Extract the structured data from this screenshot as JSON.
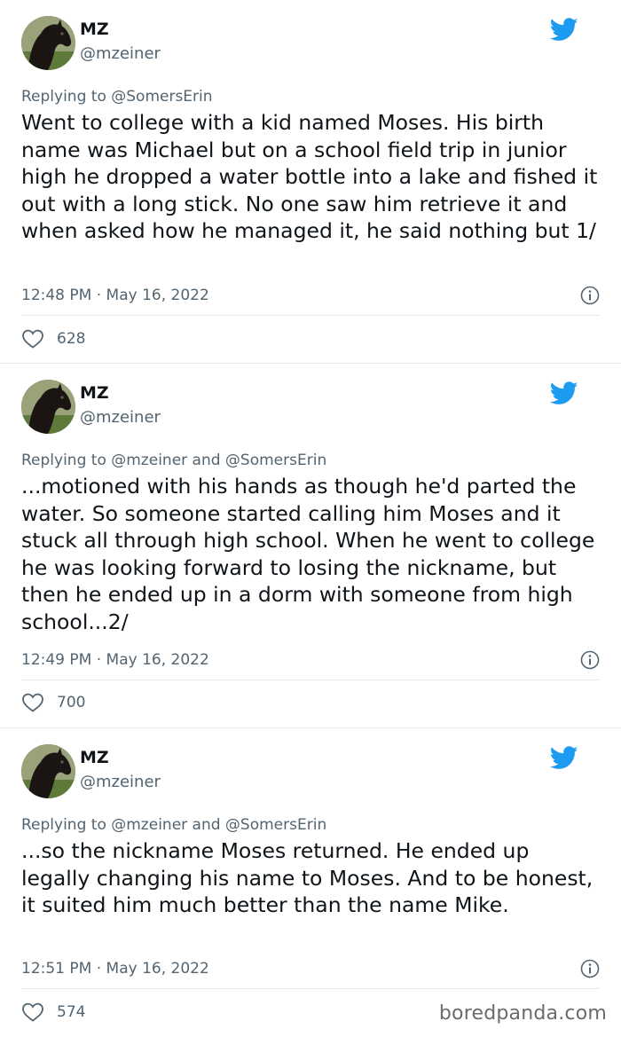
{
  "tweets": [
    {
      "name": "MZ",
      "handle": "@mzeiner",
      "replying_label": "Replying to",
      "replying_to": "@SomersErin",
      "text": "Went to college with a kid named Moses. His birth name was Michael but on a school field trip in junior high he dropped a water bottle into a lake and fished it out with a long stick. No one saw him retrieve it and when asked how he managed it, he said nothing but 1/",
      "timestamp": "12:48 PM · May 16, 2022",
      "likes": "628"
    },
    {
      "name": "MZ",
      "handle": "@mzeiner",
      "replying_label": "Replying to",
      "replying_to": "@mzeiner and @SomersErin",
      "text": "...motioned with his hands as though he'd parted the water. So someone started calling him Moses and it stuck all through high school. When he went to college he was looking forward to losing the nickname, but then he ended up in a dorm with someone from high school...2/",
      "timestamp": "12:49 PM · May 16, 2022",
      "likes": "700"
    },
    {
      "name": "MZ",
      "handle": "@mzeiner",
      "replying_label": "Replying to",
      "replying_to": "@mzeiner and @SomersErin",
      "text": "...so the nickname Moses returned. He ended up legally changing his name to Moses. And to be honest, it suited him much better than the name Mike.",
      "timestamp": "12:51 PM · May 16, 2022",
      "likes": "574"
    }
  ],
  "watermark": "boredpanda.com",
  "colors": {
    "twitter_blue": "#1d9bf0",
    "secondary_text": "#536471",
    "primary_text": "#0f1419",
    "divider": "#e1e8ed"
  },
  "icons": {
    "bird": "twitter-bird-icon",
    "info": "info-icon",
    "heart": "heart-icon"
  }
}
